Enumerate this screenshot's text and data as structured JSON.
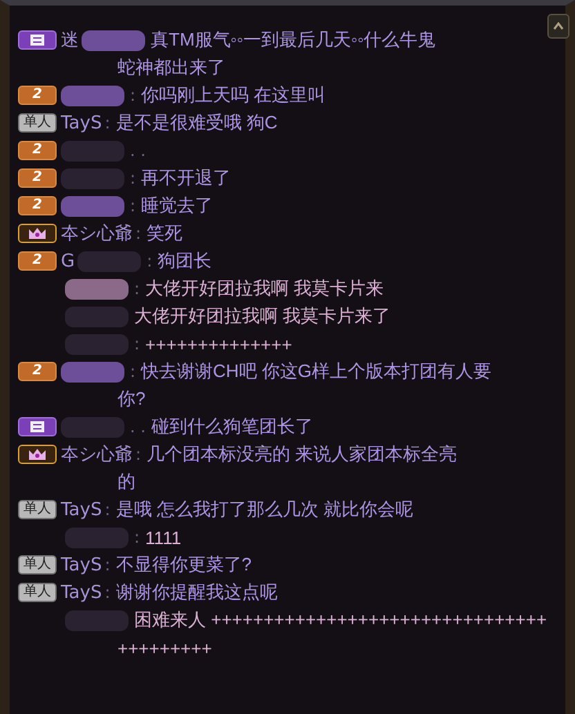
{
  "messages": [
    {
      "badge": {
        "kind": "vip"
      },
      "name": "迷",
      "smear": {
        "color": "#6c4f98"
      },
      "lines": [
        "真TM服气◦◦一到最后几天◦◦什么牛鬼",
        "蛇神都出来了"
      ],
      "color": "#ae94e4"
    },
    {
      "badge": {
        "kind": "level",
        "text": "2"
      },
      "smear": {
        "color": "#6c4f98"
      },
      "separator": ":",
      "lines": [
        "你吗刚上天吗 在这里叫"
      ],
      "color": "#ae94e4"
    },
    {
      "badge": {
        "kind": "solo",
        "text": "单人"
      },
      "name": "TayS",
      "separator": ":",
      "lines": [
        "是不是很难受哦  狗C"
      ],
      "color": "#ae94e4"
    },
    {
      "badge": {
        "kind": "level",
        "text": "2"
      },
      "smear": {
        "color": "#2a2230"
      },
      "separator": ". ."
    },
    {
      "badge": {
        "kind": "level",
        "text": "2"
      },
      "smear": {
        "color": "#2a2230"
      },
      "separator": ":",
      "lines": [
        "再不开退了"
      ],
      "color": "#ae94e4"
    },
    {
      "badge": {
        "kind": "level",
        "text": "2"
      },
      "smear": {
        "color": "#6c4f98"
      },
      "separator": ":",
      "lines": [
        "睡觉去了"
      ],
      "color": "#ae94e4"
    },
    {
      "badge": {
        "kind": "crown"
      },
      "name": "夲シ心爺",
      "separator": ":",
      "lines": [
        "笑死"
      ],
      "color": "#ae94e4"
    },
    {
      "badge": {
        "kind": "level",
        "text": "2"
      },
      "name": "G",
      "smear": {
        "color": "#2a2230"
      },
      "separator": ":",
      "lines": [
        "狗团长"
      ],
      "color": "#ae94e4"
    },
    {
      "badge": {
        "kind": "none"
      },
      "smear": {
        "color": "#8a6a88"
      },
      "separator": ":",
      "lines": [
        "大佬开好团拉我啊 我莫卡片来"
      ],
      "color": "#dcb0d4"
    },
    {
      "badge": {
        "kind": "none"
      },
      "smear": {
        "color": "#2a2230"
      },
      "lines": [
        "大佬开好团拉我啊 我莫卡片来了"
      ],
      "color": "#dcb0d4"
    },
    {
      "badge": {
        "kind": "none"
      },
      "smear": {
        "color": "#2a2230"
      },
      "separator": ":",
      "lines": [
        "++++++++++++++"
      ],
      "color": "#dcb0d4"
    },
    {
      "badge": {
        "kind": "level",
        "text": "2"
      },
      "smear": {
        "color": "#6c4f98"
      },
      "separator": ":",
      "lines": [
        "快去谢谢CH吧 你这G样上个版本打团有人要",
        "你?"
      ],
      "color": "#ae94e4"
    },
    {
      "badge": {
        "kind": "vip"
      },
      "smear": {
        "color": "#2a2230"
      },
      "separator": ". .",
      "lines": [
        "碰到什么狗笔团长了"
      ],
      "color": "#ae94e4"
    },
    {
      "badge": {
        "kind": "crown"
      },
      "name": "夲シ心爺",
      "separator": ":",
      "lines": [
        "几个团本标没亮的 来说人家团本标全亮",
        "的"
      ],
      "color": "#ae94e4"
    },
    {
      "badge": {
        "kind": "solo",
        "text": "单人"
      },
      "name": "TayS",
      "separator": ":",
      "lines": [
        "是哦  怎么我打了那么几次 就比你会呢"
      ],
      "color": "#ae94e4"
    },
    {
      "badge": {
        "kind": "none"
      },
      "smear": {
        "color": "#2a2230"
      },
      "separator": ":",
      "lines": [
        "1111"
      ],
      "color": "#dcb0d4"
    },
    {
      "badge": {
        "kind": "solo",
        "text": "单人"
      },
      "name": "TayS",
      "separator": ":",
      "lines": [
        "不显得你更菜了?"
      ],
      "color": "#ae94e4"
    },
    {
      "badge": {
        "kind": "solo",
        "text": "单人"
      },
      "name": "TayS",
      "separator": ":",
      "lines": [
        "谢谢你提醒我这点呢"
      ],
      "color": "#ae94e4"
    },
    {
      "badge": {
        "kind": "none"
      },
      "smear": {
        "color": "#2a2230"
      },
      "lines": [
        "困难来人 ++++++++++++++++++++++++++++++++",
        "+++++++++"
      ],
      "color": "#dcb0d4"
    }
  ]
}
